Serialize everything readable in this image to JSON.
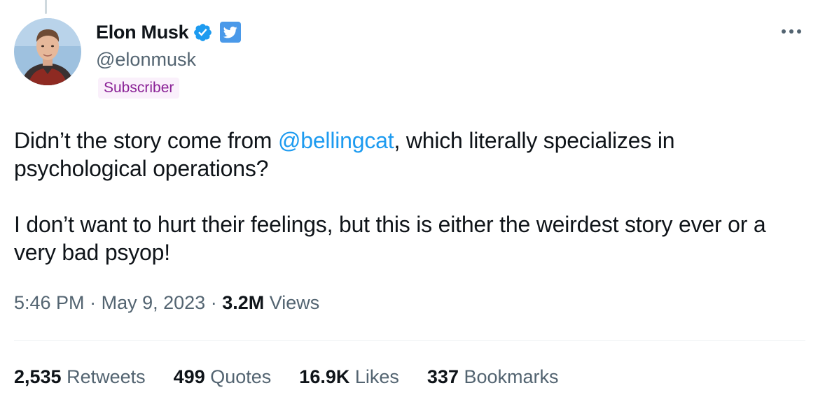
{
  "tweet": {
    "author": {
      "display_name": "Elon Musk",
      "handle": "@elonmusk",
      "badge": "Subscriber",
      "verified_icon": "verified-check-icon",
      "platform_icon": "twitter-bird-icon"
    },
    "text": {
      "p1_before": "Didn’t the story come from ",
      "mention": "@bellingcat",
      "p1_after": ", which literally specializes in psychological operations?",
      "p2": "I don’t want to hurt their feelings, but this is either the weirdest story ever or a very bad psyop!"
    },
    "meta": {
      "time": "5:46 PM",
      "separator": "·",
      "date": "May 9, 2023",
      "views_count": "3.2M",
      "views_label": "Views"
    },
    "stats": [
      {
        "count": "2,535",
        "label": "Retweets"
      },
      {
        "count": "499",
        "label": "Quotes"
      },
      {
        "count": "16.9K",
        "label": "Likes"
      },
      {
        "count": "337",
        "label": "Bookmarks"
      }
    ]
  },
  "colors": {
    "text": "#0f1419",
    "secondary": "#536471",
    "link": "#1d9bf0",
    "verified": "#1d9bf0",
    "twitter_badge": "#4a99e9",
    "subscriber_bg": "#faf0fb",
    "subscriber_text": "#8a2196"
  }
}
